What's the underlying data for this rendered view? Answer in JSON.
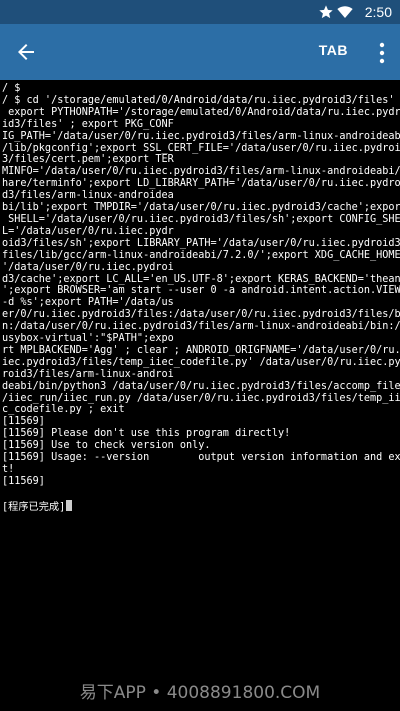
{
  "status_bar": {
    "time": "2:50",
    "icons": [
      "star-icon",
      "wifi-icon",
      "signal-icon",
      "battery-icon"
    ],
    "color": "#1f4f7a"
  },
  "toolbar": {
    "back_icon": "arrow-back-icon",
    "tab_label": "TAB",
    "overflow_icon": "more-vert-icon",
    "color": "#2c6ea6"
  },
  "terminal": {
    "lines": [
      "/ $",
      "/ $ cd '/storage/emulated/0/Android/data/ru.iiec.pydroid3/files' ;",
      " export PYTHONPATH='/storage/emulated/0/Android/data/ru.iiec.pydro",
      "id3/files' ; export PKG_CONF",
      "IG_PATH='/data/user/0/ru.iiec.pydroid3/files/arm-linux-androideabi",
      "/lib/pkgconfig';export SSL_CERT_FILE='/data/user/0/ru.iiec.pydroid",
      "3/files/cert.pem';export TER",
      "MINFO='/data/user/0/ru.iiec.pydroid3/files/arm-linux-androideabi/s",
      "hare/terminfo';export LD_LIBRARY_PATH='/data/user/0/ru.iiec.pydroi",
      "d3/files/arm-linux-androidea",
      "bi/lib';export TMPDIR='/data/user/0/ru.iiec.pydroid3/cache';export",
      " SHELL='/data/user/0/ru.iiec.pydroid3/files/sh';export CONFIG_SHEL",
      "L='/data/user/0/ru.iiec.pydr",
      "oid3/files/sh';export LIBRARY_PATH='/data/user/0/ru.iiec.pydroid3/",
      "files/lib/gcc/arm-linux-androideabi/7.2.0/';export XDG_CACHE_HOME=",
      "'/data/user/0/ru.iiec.pydroi",
      "d3/cache';export LC_ALL='en_US.UTF-8';export KERAS_BACKEND='theano",
      "';export BROWSER='am start --user 0 -a android.intent.action.VIEW",
      "-d %s';export PATH='/data/us",
      "er/0/ru.iiec.pydroid3/files:/data/user/0/ru.iiec.pydroid3/files/bi",
      "n:/data/user/0/ru.iiec.pydroid3/files/arm-linux-androideabi/bin:/b",
      "usybox-virtual':\"$PATH\";expo",
      "rt MPLBACKEND='Agg' ; clear ; ANDROID_ORIGFNAME='/data/user/0/ru.i",
      "iec.pydroid3/files/temp_iiec_codefile.py' /data/user/0/ru.iiec.pyd",
      "roid3/files/arm-linux-androi",
      "deabi/bin/python3 /data/user/0/ru.iiec.pydroid3/files/accomp_files",
      "/iiec_run/iiec_run.py /data/user/0/ru.iiec.pydroid3/files/temp_iie",
      "c_codefile.py ; exit",
      "[11569]",
      "[11569] Please don't use this program directly!",
      "[11569] Use to check version only.",
      "[11569] Usage: --version        output version information and exi",
      "t!",
      "[11569]",
      "",
      "[程序已完成]"
    ]
  },
  "watermark": "易下APP • 4008891800.COM"
}
